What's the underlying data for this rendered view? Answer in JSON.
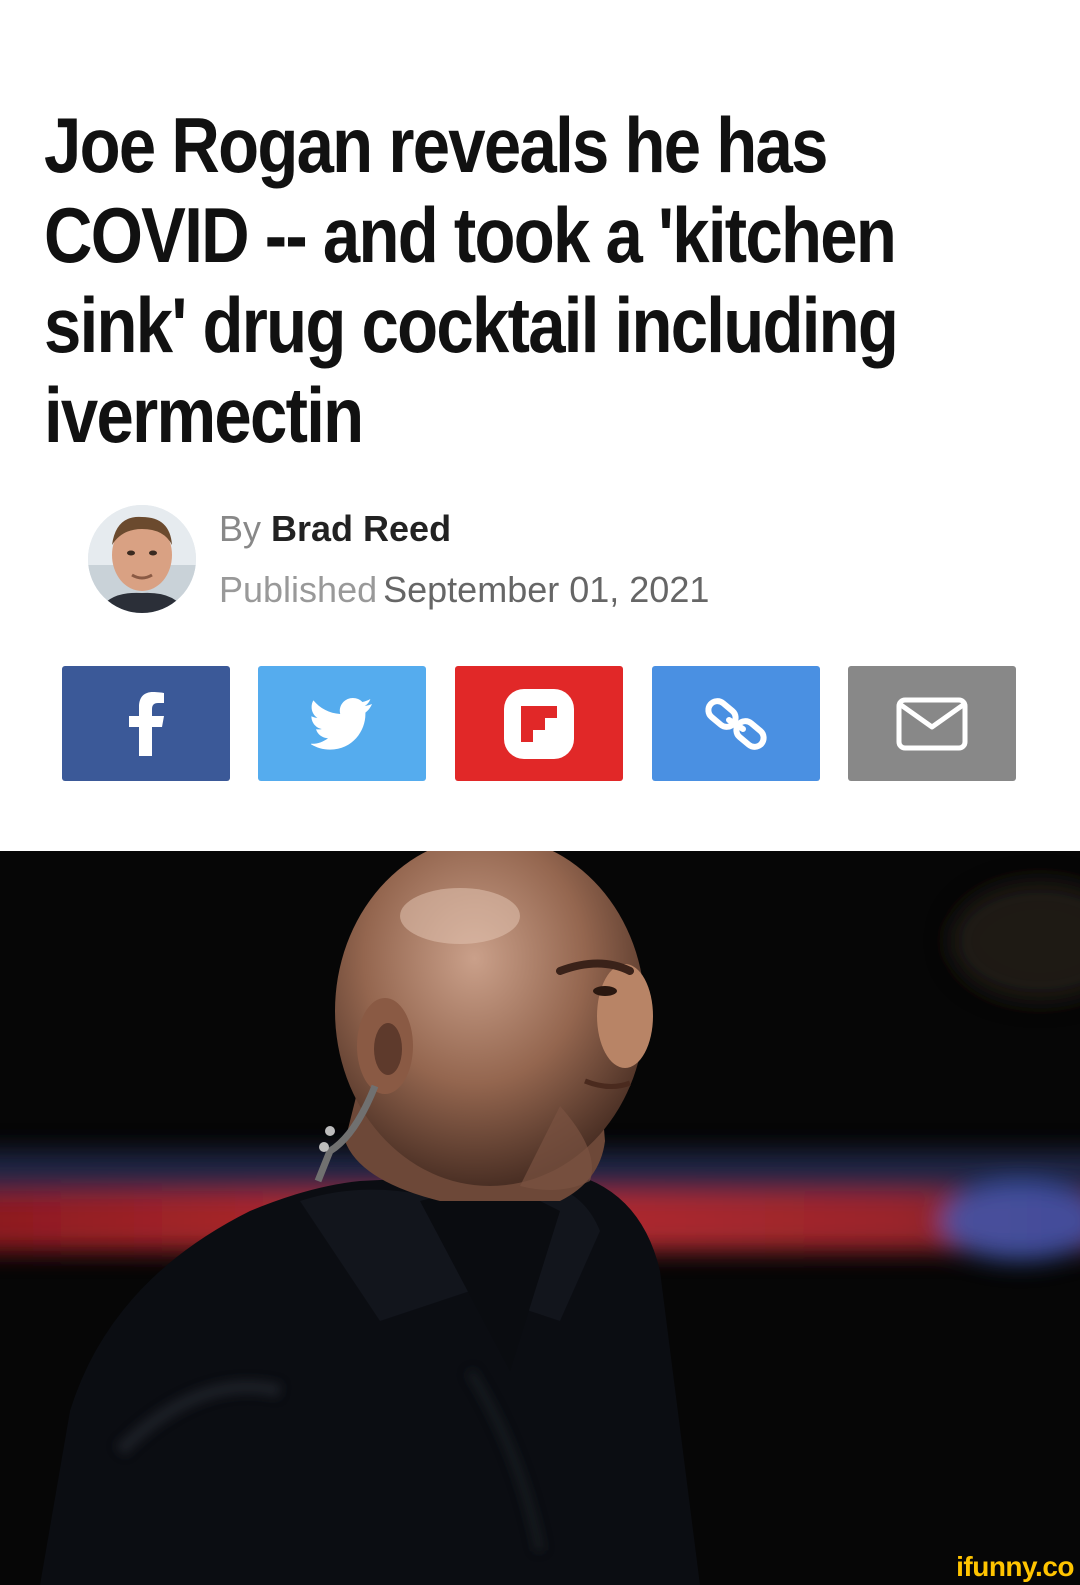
{
  "article": {
    "headline": "Joe Rogan reveals he has COVID -- and took a 'kitchen sink' drug cocktail including ivermectin",
    "byline_prefix": "By",
    "author": "Brad Reed",
    "published_prefix": "Published",
    "published_date": "September 01, 2021"
  },
  "share_buttons": [
    {
      "icon": "facebook-icon",
      "color": "#3b5998"
    },
    {
      "icon": "twitter-icon",
      "color": "#55acee"
    },
    {
      "icon": "flipboard-icon",
      "color": "#e12828"
    },
    {
      "icon": "link-icon",
      "color": "#4a90e2"
    },
    {
      "icon": "email-icon",
      "color": "#888888"
    }
  ],
  "watermark": "ifunny.co"
}
